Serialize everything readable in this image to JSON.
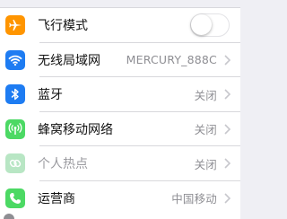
{
  "settings": {
    "items": [
      {
        "id": "airplane",
        "label": "飞行模式",
        "icon": "airplane-icon",
        "icon_color": "#ff9500",
        "control": "toggle",
        "toggle_on": false
      },
      {
        "id": "wifi",
        "label": "无线局域网",
        "icon": "wifi-icon",
        "icon_color": "#1e7cf2",
        "value": "MERCURY_888C",
        "control": "chevron"
      },
      {
        "id": "bluetooth",
        "label": "蓝牙",
        "icon": "bluetooth-icon",
        "icon_color": "#1e7cf2",
        "value": "关闭",
        "control": "chevron"
      },
      {
        "id": "cellular",
        "label": "蜂窝移动网络",
        "icon": "cellular-antenna-icon",
        "icon_color": "#4cd964",
        "value": "关闭",
        "control": "chevron"
      },
      {
        "id": "hotspot",
        "label": "个人热点",
        "icon": "personal-hotspot-icon",
        "icon_color": "#b8e6c4",
        "value": "关闭",
        "control": "chevron",
        "disabled": true
      },
      {
        "id": "carrier",
        "label": "运营商",
        "icon": "phone-icon",
        "icon_color": "#4cd964",
        "value": "中国移动",
        "control": "chevron"
      }
    ]
  },
  "colors": {
    "chevron": "#c7c7cc",
    "value_text": "#8e8e93",
    "separator": "#d8d8dc",
    "group_background": "#efeff4"
  }
}
